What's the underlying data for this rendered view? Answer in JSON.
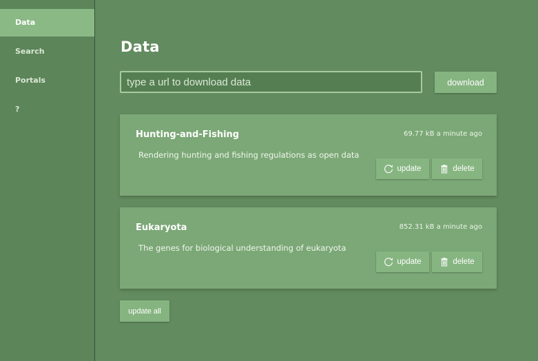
{
  "sidebar": {
    "items": [
      {
        "label": "Data",
        "active": true
      },
      {
        "label": "Search",
        "active": false
      },
      {
        "label": "Portals",
        "active": false
      },
      {
        "label": "?",
        "active": false
      }
    ]
  },
  "main": {
    "title": "Data",
    "url_input": {
      "placeholder": "type a url to download data",
      "value": ""
    },
    "download_label": "download",
    "datasets": [
      {
        "name": "Hunting-and-Fishing",
        "description": "Rendering hunting and fishing regulations as open data",
        "size": "69.77 kB",
        "updated": "a minute ago",
        "update_label": "update",
        "delete_label": "delete"
      },
      {
        "name": "Eukaryota",
        "description": "The genes for biological understanding of eukaryota",
        "size": "852.31 kB",
        "updated": "a minute ago",
        "update_label": "update",
        "delete_label": "delete"
      }
    ],
    "update_all_label": "update all"
  },
  "icons": {
    "update": "refresh-icon",
    "delete": "trash-icon"
  },
  "colors": {
    "background": "#628b5f",
    "sidebar": "#5c855a",
    "active_item": "#8ab985",
    "card": "#7ba876",
    "button": "#85b480"
  }
}
